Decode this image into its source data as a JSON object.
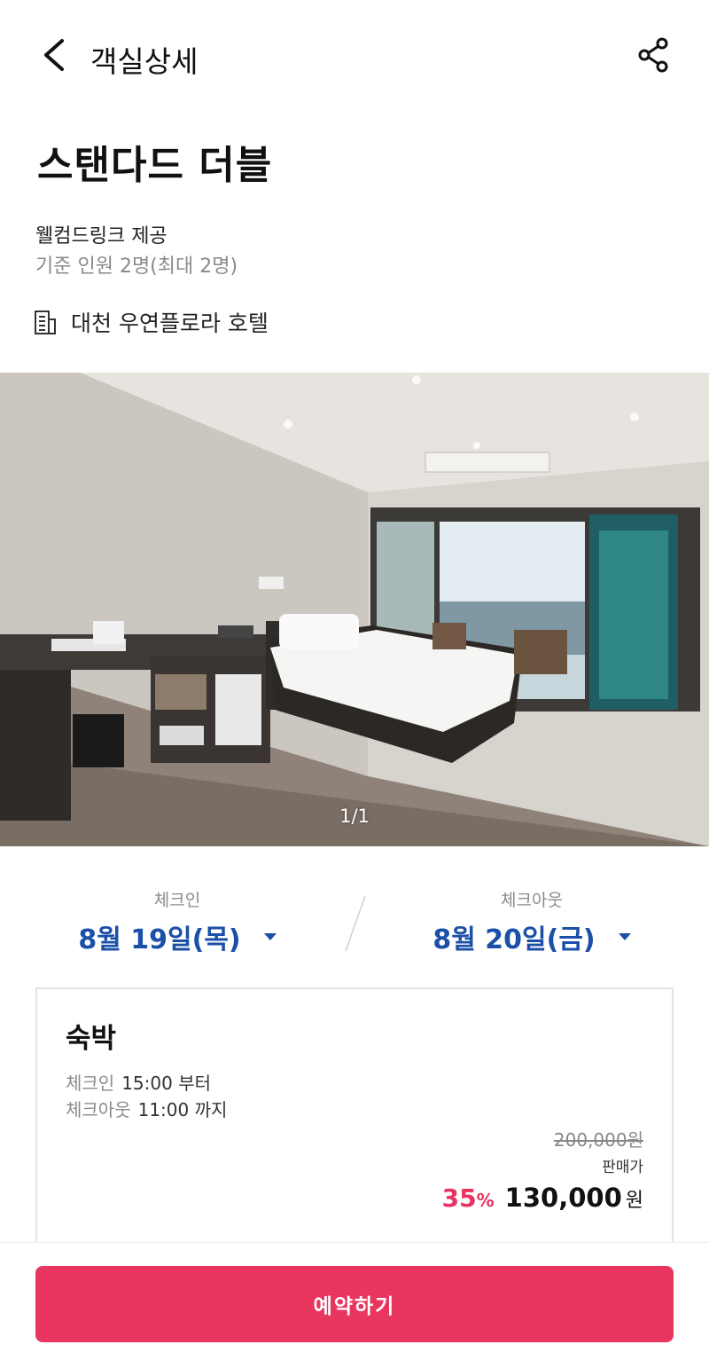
{
  "header": {
    "title": "객실상세"
  },
  "room": {
    "name": "스탠다드 더블",
    "benefit": "웰컴드링크 제공",
    "capacity": "기준 인원 2명(최대 2명)",
    "hotel_name": "대천 우연플로라 호텔"
  },
  "gallery": {
    "counter": "1/1"
  },
  "dates": {
    "checkin_label": "체크인",
    "checkin_value": "8월 19일(목)",
    "checkout_label": "체크아웃",
    "checkout_value": "8월 20일(금)"
  },
  "option": {
    "title": "숙박",
    "checkin_label": "체크인",
    "checkin_time": "15:00 부터",
    "checkout_label": "체크아웃",
    "checkout_time": "11:00 까지",
    "original_price": "200,000원",
    "sale_label": "판매가",
    "discount": "35",
    "discount_unit": "%",
    "price": "130,000",
    "currency": "원"
  },
  "footer": {
    "reserve_label": "예약하기"
  },
  "colors": {
    "accent": "#e8365f",
    "date_blue": "#1b4fa8",
    "discount": "#e8325f"
  },
  "icons": {
    "back": "chevron-left-icon",
    "share": "share-icon",
    "hotel": "building-icon",
    "date_caret": "caret-down-icon"
  }
}
